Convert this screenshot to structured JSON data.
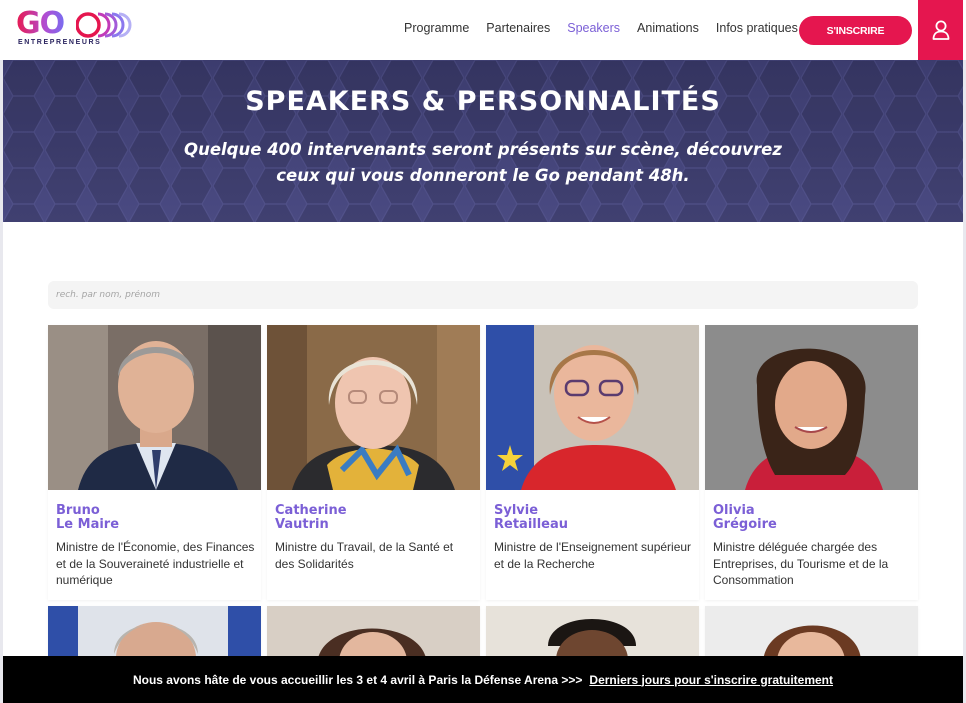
{
  "brand": {
    "logo_text": "GO",
    "tagline": "ENTREPRENEURS",
    "accent": "#e5164f",
    "purple": "#7b5fd6"
  },
  "nav": {
    "items": [
      {
        "label": "Programme",
        "active": false
      },
      {
        "label": "Partenaires",
        "active": false
      },
      {
        "label": "Speakers",
        "active": true
      },
      {
        "label": "Animations",
        "active": false
      },
      {
        "label": "Infos pratiques",
        "active": false
      }
    ],
    "signup_label": "S'INSCRIRE"
  },
  "hero": {
    "title": "SPEAKERS & PERSONNALITÉS",
    "subtitle": "Quelque 400 intervenants seront présents sur scène, découvrez ceux qui vous donneront le Go pendant 48h."
  },
  "search": {
    "placeholder": "rech. par nom, prénom",
    "value": ""
  },
  "speakers": [
    {
      "first": "Bruno",
      "last": "Le Maire",
      "role": "Ministre de l'Économie, des Finances et de la Souveraineté industrielle et numérique"
    },
    {
      "first": "Catherine",
      "last": "Vautrin",
      "role": "Ministre du Travail, de la Santé et des Solidarités"
    },
    {
      "first": "Sylvie",
      "last": "Retailleau",
      "role": "Ministre de l'Enseignement supérieur et de la Recherche"
    },
    {
      "first": "Olivia",
      "last": "Grégoire",
      "role": "Ministre déléguée chargée des Entreprises, du Tourisme et de la Consommation"
    }
  ],
  "banner": {
    "text": "Nous avons hâte de vous accueillir les 3 et 4 avril à Paris la Défense Arena >>>",
    "link": "Derniers jours pour s'inscrire gratuitement"
  }
}
